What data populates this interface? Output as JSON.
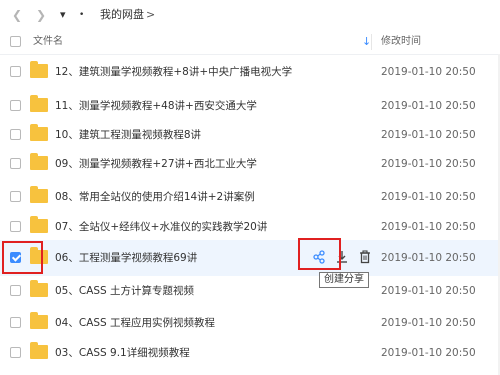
{
  "nav": {
    "back_icon": "chevron-left-icon",
    "forward_icon": "chevron-right-icon",
    "dropdown_icon": "caret-down-icon",
    "dot": "•",
    "breadcrumb": "我的网盘",
    "breadcrumb_separator": ">"
  },
  "header": {
    "name_label": "文件名",
    "time_label": "修改时间",
    "sort_icon": "arrow-down-icon"
  },
  "rows": [
    {
      "name": "12、建筑测量学视频教程+8讲+中央广播电视大学",
      "time": "2019-01-10 20:50",
      "selected": false
    },
    {
      "name": "11、测量学视频教程+48讲+西安交通大学",
      "time": "2019-01-10 20:50",
      "selected": false
    },
    {
      "name": "10、建筑工程测量视频教程8讲",
      "time": "2019-01-10 20:50",
      "selected": false
    },
    {
      "name": "09、测量学视频教程+27讲+西北工业大学",
      "time": "2019-01-10 20:50",
      "selected": false
    },
    {
      "name": "08、常用全站仪的使用介绍14讲+2讲案例",
      "time": "2019-01-10 20:50",
      "selected": false
    },
    {
      "name": "07、全站仪+经纬仪+水准仪的实践教学20讲",
      "time": "2019-01-10 20:50",
      "selected": false
    },
    {
      "name": "06、工程测量学视频教程69讲",
      "time": "2019-01-10 20:50",
      "selected": true
    },
    {
      "name": "05、CASS 土方计算专题视频",
      "time": "2019-01-10 20:50",
      "selected": false
    },
    {
      "name": "04、CASS 工程应用实例视频教程",
      "time": "2019-01-10 20:50",
      "selected": false
    },
    {
      "name": "03、CASS 9.1详细视频教程",
      "time": "2019-01-10 20:50",
      "selected": false
    }
  ],
  "row_actions": {
    "share_icon": "share-icon",
    "download_icon": "download-icon",
    "delete_icon": "trash-icon"
  },
  "tooltip": "创建分享",
  "colors": {
    "accent": "#3b8cff",
    "folder": "#f7c23e",
    "selected_row": "#eef5fe",
    "highlight": "#e02020"
  }
}
